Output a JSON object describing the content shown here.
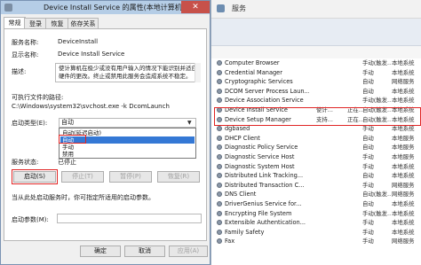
{
  "services_window": {
    "title": "服务",
    "rows": [
      {
        "name": "Computer Browser",
        "description": "",
        "status": "",
        "startup": "手动(触发...",
        "logon": "本地系统"
      },
      {
        "name": "Credential Manager",
        "description": "",
        "status": "",
        "startup": "手动",
        "logon": "本地系统"
      },
      {
        "name": "Cryptographic Services",
        "description": "",
        "status": "",
        "startup": "自动",
        "logon": "网络服务"
      },
      {
        "name": "DCOM Server Process Laun...",
        "description": "",
        "status": "",
        "startup": "自动",
        "logon": "本地系统"
      },
      {
        "name": "Device Association Service",
        "description": "",
        "status": "",
        "startup": "手动(触发...",
        "logon": "本地系统"
      },
      {
        "name": "Device Install Service",
        "description": "使计...",
        "status": "正在...",
        "startup": "自动(触发...",
        "logon": "本地系统"
      },
      {
        "name": "Device Setup Manager",
        "description": "支持...",
        "status": "正在...",
        "startup": "自动(触发...",
        "logon": "本地系统"
      },
      {
        "name": "dgbased",
        "description": "",
        "status": "",
        "startup": "手动",
        "logon": "本地系统"
      },
      {
        "name": "DHCP Client",
        "description": "",
        "status": "",
        "startup": "自动",
        "logon": "本地服务"
      },
      {
        "name": "Diagnostic Policy Service",
        "description": "",
        "status": "",
        "startup": "自动",
        "logon": "本地服务"
      },
      {
        "name": "Diagnostic Service Host",
        "description": "",
        "status": "",
        "startup": "手动",
        "logon": "本地服务"
      },
      {
        "name": "Diagnostic System Host",
        "description": "",
        "status": "",
        "startup": "手动",
        "logon": "本地系统"
      },
      {
        "name": "Distributed Link Tracking...",
        "description": "",
        "status": "",
        "startup": "自动",
        "logon": "本地系统"
      },
      {
        "name": "Distributed Transaction C...",
        "description": "",
        "status": "",
        "startup": "手动",
        "logon": "网络服务"
      },
      {
        "name": "DNS Client",
        "description": "",
        "status": "",
        "startup": "自动(触发...",
        "logon": "网络服务"
      },
      {
        "name": "DriverGenius Service for...",
        "description": "",
        "status": "",
        "startup": "自动",
        "logon": "本地系统"
      },
      {
        "name": "Encrypting File System",
        "description": "",
        "status": "",
        "startup": "手动(触发...",
        "logon": "本地系统"
      },
      {
        "name": "Extensible Authentication...",
        "description": "",
        "status": "",
        "startup": "手动",
        "logon": "本地系统"
      },
      {
        "name": "Family Safety",
        "description": "",
        "status": "",
        "startup": "手动",
        "logon": "本地系统"
      },
      {
        "name": "Fax",
        "description": "",
        "status": "",
        "startup": "手动",
        "logon": "网络服务"
      }
    ]
  },
  "dialog": {
    "title": "Device Install Service 的属性(本地计算机)",
    "close_glyph": "✕",
    "tabs": [
      "常规",
      "登录",
      "恢复",
      "依存关系"
    ],
    "service_name_label": "服务名称:",
    "service_name": "DeviceInstall",
    "display_name_label": "显示名称:",
    "display_name": "Device Install Service",
    "description_label": "描述:",
    "description": "使计算机在极少或没有用户输入的情况下能识别并适应硬件的更改。终止或禁用此服务会造成系统不稳定。",
    "path_label": "可执行文件的路径:",
    "path": "C:\\Windows\\system32\\svchost.exe -k DcomLaunch",
    "startup_type_label": "启动类型(E):",
    "startup_type_value": "自动",
    "startup_options": [
      "自动(延迟启动)",
      "自动",
      "手动",
      "禁用"
    ],
    "selected_option_index": 1,
    "status_label": "服务状态:",
    "status_value": "已停止",
    "buttons": {
      "start": "启动(S)",
      "stop": "停止(T)",
      "pause": "暂停(P)",
      "resume": "恢复(R)"
    },
    "hint": "当从此处启动服务时，你可指定所适用的启动参数。",
    "params_label": "启动参数(M):",
    "ok": "确定",
    "cancel": "取消",
    "apply": "应用(A)"
  },
  "colors": {
    "highlight": "#e02424",
    "selected": "#3478d5",
    "titlebar": "#b5cde6",
    "close": "#c7514a"
  }
}
